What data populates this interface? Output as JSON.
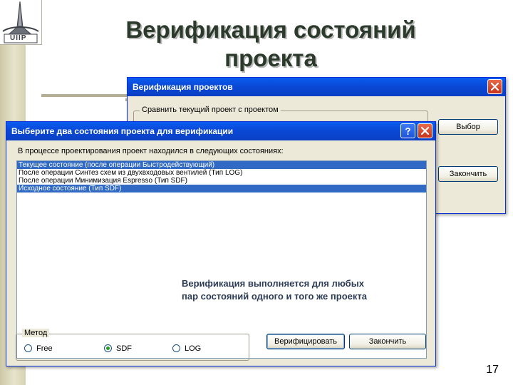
{
  "slide": {
    "title": "Верификация состояний проекта",
    "page_number": "17"
  },
  "logo": {
    "text": "UIIP"
  },
  "window_back": {
    "title": "Верификация проектов",
    "group_label": "Сравнить текущий проект с проектом",
    "choose_button": "Выбор",
    "finish_button": "Закончить"
  },
  "window_front": {
    "title": "Выберите два состояния проекта  для верификации",
    "instruction": "В процессе проектирования проект находился в следующих состояниях:",
    "states": [
      {
        "label": "Текущее состояние (после операции Быстродействующий)",
        "selected": true
      },
      {
        "label": "После операции Синтез схем из двухвходовых вентилей (Тип LOG)",
        "selected": false
      },
      {
        "label": "После операции Минимизация Espresso (Тип SDF)",
        "selected": false
      },
      {
        "label": "Исходное состояние (Тип SDF)",
        "selected": true
      }
    ],
    "note_line1": "Верификация выполняется для любых",
    "note_line2": "пар состояний одного и того же проекта",
    "method_label": "Метод",
    "methods": [
      {
        "label": "Free",
        "checked": false
      },
      {
        "label": "SDF",
        "checked": true
      },
      {
        "label": "LOG",
        "checked": false
      }
    ],
    "verify_button": "Верифицировать",
    "finish_button": "Закончить"
  },
  "colors": {
    "titlebar": "#0a49d6",
    "selection": "#316ac5",
    "window_bg": "#ece9d8"
  }
}
